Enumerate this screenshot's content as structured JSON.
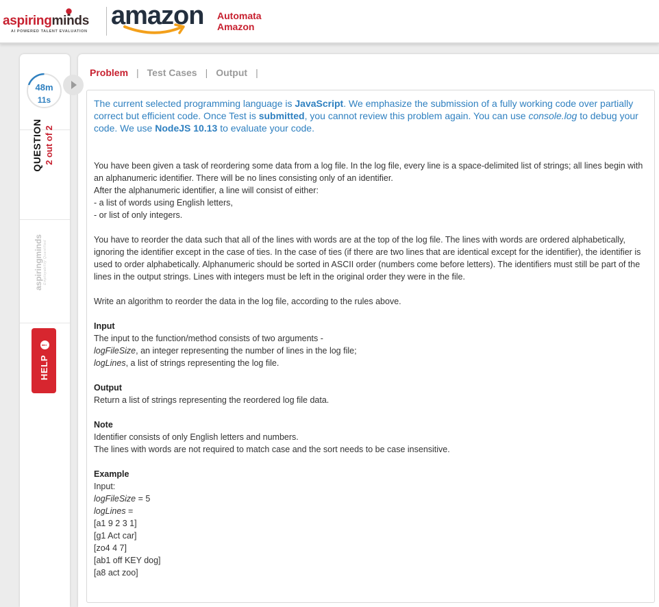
{
  "header": {
    "logo_aspiring": "aspiring",
    "logo_minds": "minds",
    "logo_tagline": "AI POWERED TALENT EVALUATION",
    "amazon_word": "amazon",
    "product_line1": "Automata",
    "product_line2": "Amazon"
  },
  "sidebar": {
    "timer_minutes": "48m",
    "timer_seconds": "11s",
    "question_word": "QUESTION",
    "question_count": "2 out of 2",
    "watermark": "aspiringminds",
    "watermark_tag": "Employability Quantified",
    "help_label": "HELP",
    "help_icon": "!"
  },
  "tabs": [
    "Problem",
    "Test Cases",
    "Output"
  ],
  "tab_separator": "|",
  "notice": {
    "t1": "The current selected programming language is ",
    "lang": "JavaScript",
    "t2": ". We emphasize the submission of a fully working code over partially correct but efficient code. Once Test is ",
    "submitted": "submitted",
    "t3": ", you cannot review this problem again. You can use ",
    "console": "console.log",
    "t4": " to debug your code. We use ",
    "node": "NodeJS 10.13",
    "t5": " to evaluate your code."
  },
  "problem": {
    "p1": "You have been given a task of reordering some data from a log file. In the log file, every line is a space-delimited list of strings; all lines begin with an alphanumeric identifier. There will be no lines consisting only of an identifier.",
    "p2": "After the alphanumeric identifier, a line will consist of either:",
    "p3": "- a list of words using English letters,",
    "p4": "- or list of only integers.",
    "p5": "You have to reorder the data such that all of the lines with words are at the top of the log file. The lines with words are ordered alphabetically, ignoring the identifier except in the case of ties. In the case of ties (if there are two lines that are identical except for the identifier), the identifier is used to order alphabetically. Alphanumeric should be sorted in ASCII order (numbers come before letters). The identifiers must still be part of the lines in the output strings. Lines with integers must be left in the original order they were in the file.",
    "p6": "Write an algorithm to reorder the data in the log file, according to the rules above.",
    "input_heading": "Input",
    "input_line": "The input to the function/method consists of two arguments -",
    "arg1_name": "logFileSize",
    "arg1_desc": ", an integer representing the number of lines in the log file;",
    "arg2_name": "logLines",
    "arg2_desc": ", a list of strings representing the log file.",
    "output_heading": "Output",
    "output_line": "Return a list of strings representing the reordered log file data.",
    "note_heading": "Note",
    "note_line1": "Identifier consists of only English letters and numbers.",
    "note_line2": "The lines with words are not required to match case and the sort needs to be case insensitive.",
    "example_heading": "Example",
    "example_input": "Input:",
    "ex_size_name": "logFileSize",
    "ex_size_val": " = 5",
    "ex_lines_name": "logLines",
    "ex_lines_val": " =",
    "ex_rows": [
      "[a1 9 2 3 1]",
      "[g1 Act car]",
      "[zo4 4 7]",
      "[ab1 off KEY dog]",
      "[a8 act zoo]"
    ]
  },
  "colors": {
    "accent_red": "#c7202f",
    "info_blue": "#2f80c0",
    "help_red": "#d7262f"
  }
}
